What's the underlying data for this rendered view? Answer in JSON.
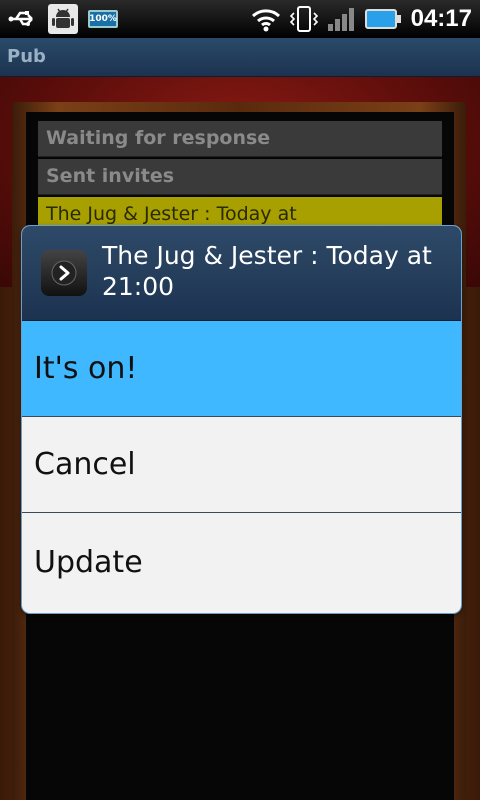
{
  "statusbar": {
    "time": "04:17",
    "battery_small_label": "100%",
    "icons": [
      "usb-icon",
      "android-debug-icon",
      "battery-notification-icon",
      "wifi-icon",
      "vibrate-icon",
      "signal-icon",
      "battery-icon"
    ]
  },
  "app": {
    "title": "Pub"
  },
  "background_list": {
    "items": [
      "Waiting for response",
      "Sent invites",
      "The Jug & Jester : Today at"
    ]
  },
  "dialog": {
    "title": "The Jug & Jester : Today at 21:00",
    "icon": "chevron-right-icon",
    "options": [
      {
        "label": "It's on!",
        "selected": true
      },
      {
        "label": "Cancel",
        "selected": false
      },
      {
        "label": "Update",
        "selected": false
      }
    ]
  },
  "colors": {
    "selected_option": "#3fb8ff",
    "dialog_header": "#1c3350",
    "highlight_row": "#a8a000"
  }
}
